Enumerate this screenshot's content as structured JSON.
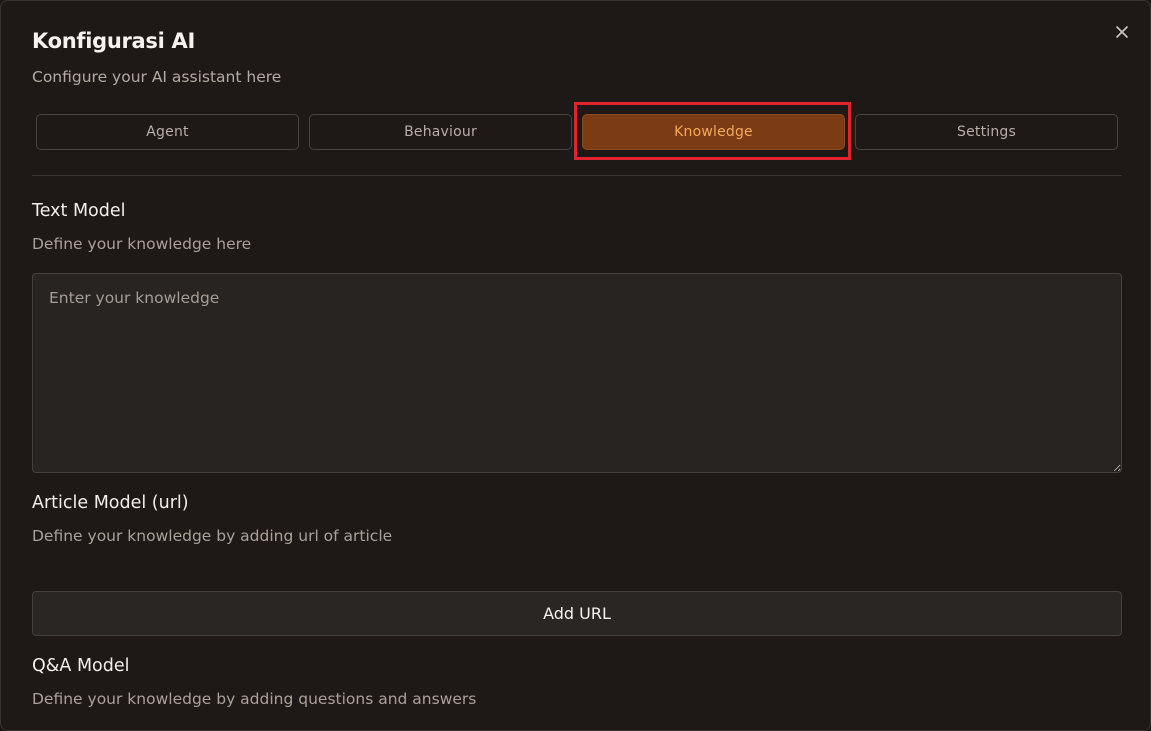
{
  "dialog": {
    "title": "Konfigurasi AI",
    "subtitle": "Configure your AI assistant here",
    "close_icon": "close-icon"
  },
  "tabs": [
    {
      "label": "Agent",
      "active": false
    },
    {
      "label": "Behaviour",
      "active": false
    },
    {
      "label": "Knowledge",
      "active": true
    },
    {
      "label": "Settings",
      "active": false
    }
  ],
  "sections": {
    "text_model": {
      "title": "Text Model",
      "description": "Define your knowledge here",
      "placeholder": "Enter your knowledge",
      "value": ""
    },
    "article_model": {
      "title": "Article Model (url)",
      "description": "Define your knowledge by adding url of article",
      "add_button_label": "Add URL"
    },
    "qa_model": {
      "title": "Q&A Model",
      "description": "Define your knowledge by adding questions and answers"
    }
  },
  "colors": {
    "accent_bg": "#7b3b14",
    "accent_text": "#f6a85a",
    "highlight": "#e0232c",
    "background": "#1e1917"
  }
}
